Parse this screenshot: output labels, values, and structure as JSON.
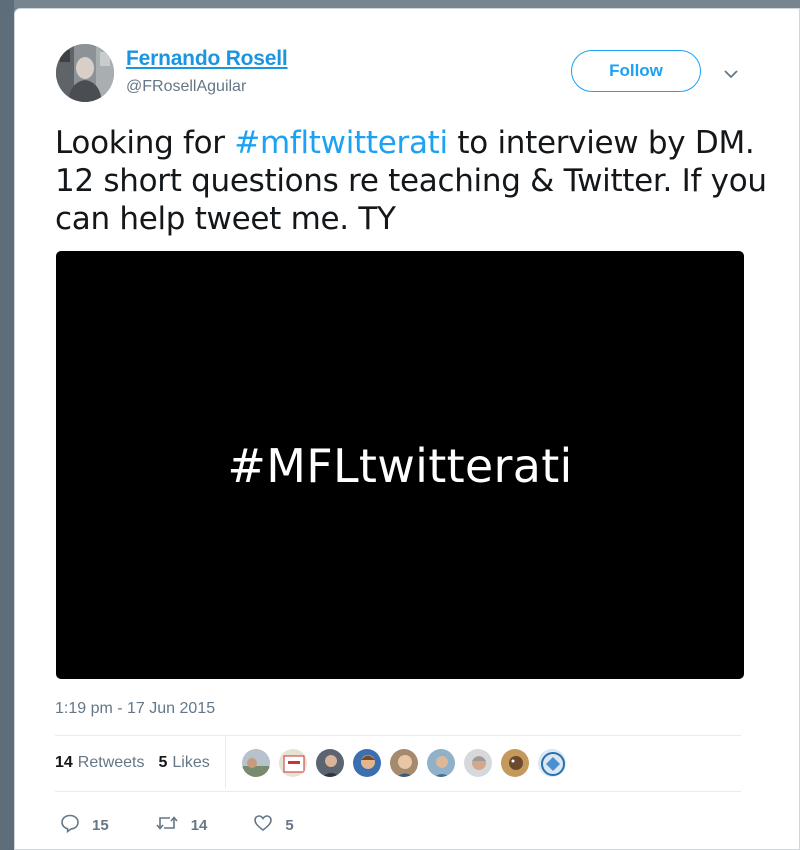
{
  "tweet": {
    "author_name": "Fernando Rosell",
    "author_handle": "@FRosellAguilar",
    "follow_label": "Follow",
    "text_before": "Looking for ",
    "hashtag": "#mfltwitterati",
    "text_after": " to interview by DM. 12 short questions re teaching & Twitter. If you can help tweet me. TY",
    "media_text": "#MFLtwitterati",
    "timestamp": "1:19 pm - 17 Jun 2015"
  },
  "stats": {
    "retweets_count": "14",
    "retweets_label": "Retweets",
    "likes_count": "5",
    "likes_label": "Likes",
    "liker_avatar_count": 9
  },
  "actions": {
    "reply_count": "15",
    "retweet_count": "14",
    "like_count": "5"
  },
  "colors": {
    "link_blue": "#1b95e0",
    "hashtag_blue": "#1da1f2",
    "secondary_text": "#657786",
    "media_background": "#000000"
  },
  "icons": [
    "chevron-down-icon",
    "reply-icon",
    "retweet-icon",
    "heart-icon"
  ]
}
